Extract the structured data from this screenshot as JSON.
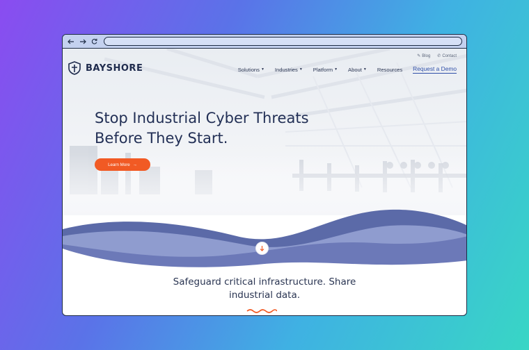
{
  "browser": {
    "back_icon": "arrow-left-icon",
    "forward_icon": "arrow-right-icon",
    "reload_icon": "reload-icon"
  },
  "site": {
    "brand": "BAYSHORE",
    "utility_links": [
      {
        "label": "Blog",
        "icon": "blog-icon"
      },
      {
        "label": "Contact",
        "icon": "phone-icon"
      }
    ],
    "nav": [
      {
        "label": "Solutions",
        "has_dropdown": true
      },
      {
        "label": "Industries",
        "has_dropdown": true
      },
      {
        "label": "Platform",
        "has_dropdown": true
      },
      {
        "label": "About",
        "has_dropdown": true
      },
      {
        "label": "Resources",
        "has_dropdown": false
      }
    ],
    "demo_label": "Request a Demo"
  },
  "hero": {
    "headline_line1": "Stop Industrial Cyber Threats",
    "headline_line2": "Before They Start.",
    "cta_label": "Learn More",
    "cta_color": "#f15a24"
  },
  "section": {
    "tagline_line1": "Safeguard critical infrastructure. Share",
    "tagline_line2": "industrial data.",
    "accent_color": "#f15a24",
    "wave_colors": [
      "#5b6aa8",
      "#8f9ccf",
      "#6c79b8"
    ]
  }
}
